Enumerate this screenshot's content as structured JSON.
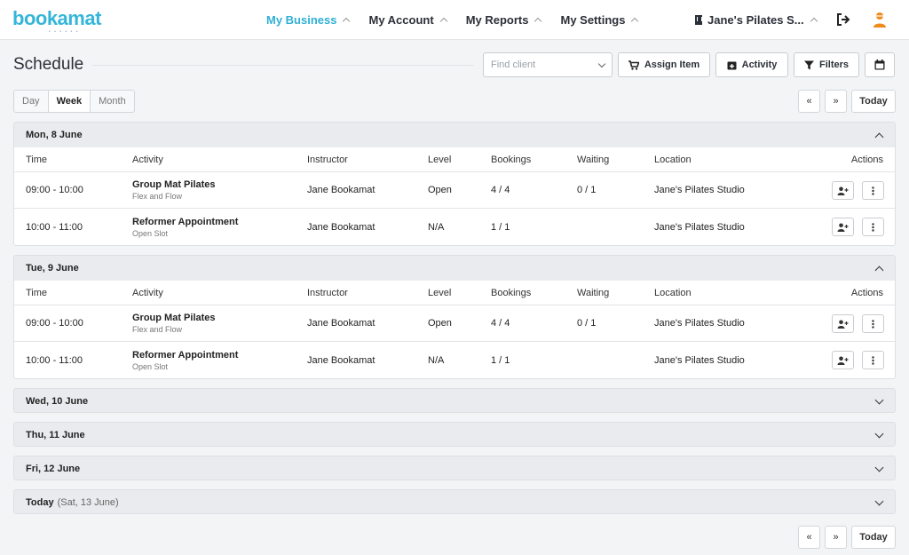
{
  "brand": {
    "logo": "bookamat"
  },
  "nav": {
    "items": [
      {
        "label": "My Business",
        "active": true
      },
      {
        "label": "My Account",
        "active": false
      },
      {
        "label": "My Reports",
        "active": false
      },
      {
        "label": "My Settings",
        "active": false
      }
    ],
    "business": "Jane's Pilates S..."
  },
  "header": {
    "title": "Schedule",
    "find_client_placeholder": "Find client",
    "assign_item": "Assign Item",
    "activity": "Activity",
    "filters": "Filters"
  },
  "view_toggle": {
    "day": "Day",
    "week": "Week",
    "month": "Month",
    "selected": "Week"
  },
  "pager": {
    "prev": "«",
    "next": "»",
    "today": "Today"
  },
  "columns": {
    "time": "Time",
    "activity": "Activity",
    "instructor": "Instructor",
    "level": "Level",
    "bookings": "Bookings",
    "waiting": "Waiting",
    "location": "Location",
    "actions": "Actions"
  },
  "days": [
    {
      "label": "Mon, 8 June",
      "expanded": true,
      "rows": [
        {
          "time": "09:00 - 10:00",
          "activity": "Group Mat Pilates",
          "sub": "Flex and Flow",
          "instructor": "Jane Bookamat",
          "level": "Open",
          "bookings": "4 / 4",
          "waiting": "0 / 1",
          "location": "Jane's Pilates Studio"
        },
        {
          "time": "10:00 - 11:00",
          "activity": "Reformer Appointment",
          "sub": "Open Slot",
          "instructor": "Jane Bookamat",
          "level": "N/A",
          "bookings": "1 / 1",
          "waiting": "",
          "location": "Jane's Pilates Studio"
        }
      ]
    },
    {
      "label": "Tue, 9 June",
      "expanded": true,
      "rows": [
        {
          "time": "09:00 - 10:00",
          "activity": "Group Mat Pilates",
          "sub": "Flex and Flow",
          "instructor": "Jane Bookamat",
          "level": "Open",
          "bookings": "4 / 4",
          "waiting": "0 / 1",
          "location": "Jane's Pilates Studio"
        },
        {
          "time": "10:00 - 11:00",
          "activity": "Reformer Appointment",
          "sub": "Open Slot",
          "instructor": "Jane Bookamat",
          "level": "N/A",
          "bookings": "1 / 1",
          "waiting": "",
          "location": "Jane's Pilates Studio"
        }
      ]
    },
    {
      "label": "Wed, 10 June",
      "expanded": false
    },
    {
      "label": "Thu, 11 June",
      "expanded": false
    },
    {
      "label": "Fri, 12 June",
      "expanded": false
    },
    {
      "label": "Today",
      "sublabel": "(Sat, 13 June)",
      "expanded": false
    }
  ],
  "colors": {
    "accent": "#2fb0d5",
    "user_icon": "#f08a1c"
  }
}
